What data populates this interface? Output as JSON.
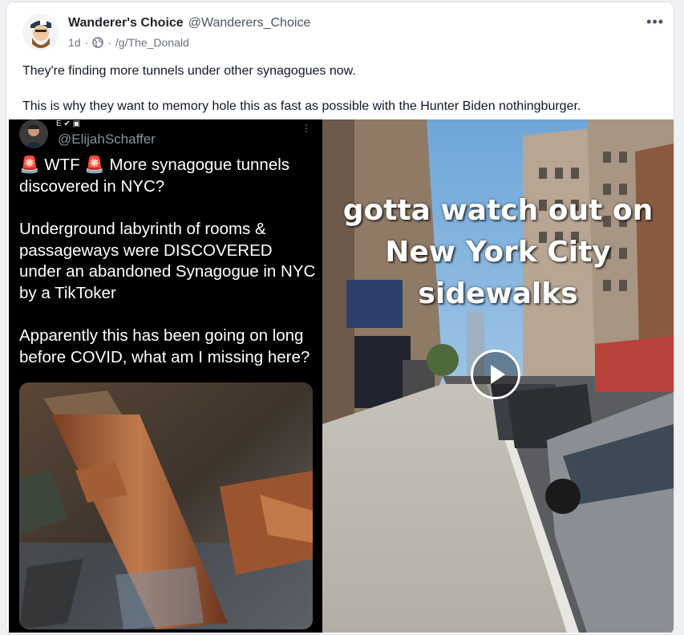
{
  "post": {
    "author": {
      "display_name": "Wanderer's Choice",
      "handle": "@Wanderers_Choice",
      "avatar_icon": "avatar-cartoon-icon"
    },
    "meta": {
      "age": "1d",
      "separator": "·",
      "community": "/g/The_Donald",
      "visibility_icon": "globe-icon"
    },
    "more_label": "•••",
    "body": [
      "They're finding more tunnels under other synagogues now.",
      "This is why they want to memory hole this as fast as possible with the Hunter Biden nothingburger."
    ]
  },
  "media": {
    "left": {
      "tweet_handle": "@ElijahSchaffer",
      "tweet_icons": "E ✔ ▣",
      "tweet_menu": "⋮",
      "tweet_paragraphs": [
        "🚨 WTF 🚨 More synagogue tunnels discovered in NYC?",
        "Underground labyrinth of rooms & passageways were DISCOVERED under an abandoned Synagogue in NYC by a TikToker",
        "Apparently this has been going on long before COVID, what am I missing here?"
      ]
    },
    "right": {
      "overlay_lines": [
        "gotta watch out on",
        "New York City",
        "sidewalks"
      ],
      "play_icon": "play-icon"
    }
  },
  "colors": {
    "text_primary": "#111827",
    "text_secondary": "#6b7280",
    "tweet_bg": "#000000",
    "overlay_text": "#ffffff"
  }
}
